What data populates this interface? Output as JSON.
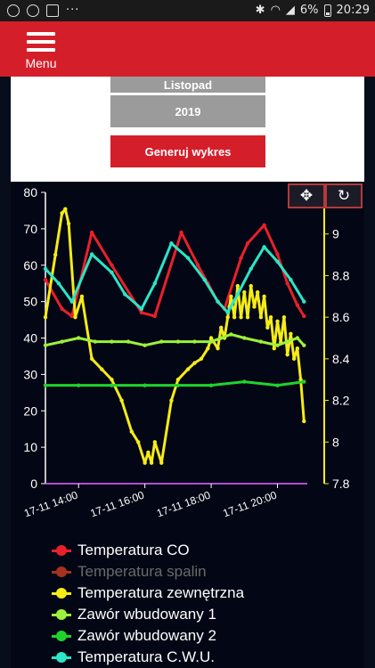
{
  "status_bar": {
    "left_icons": [
      "chrome-icon",
      "shield-icon",
      "image-icon",
      "more-dots-icon"
    ],
    "dots": "···",
    "battery": "6%",
    "time": "20:29"
  },
  "app_bar": {
    "menu_label": "Menu"
  },
  "controls": {
    "month": "Listopad",
    "year": "2019",
    "generate": "Generuj wykres"
  },
  "chart_data": {
    "type": "line",
    "x_tick_labels": [
      "17-11 14:00",
      "17-11 16:00",
      "17-11 18:00",
      "17-11 20:00"
    ],
    "x_tick_hours": [
      14,
      16,
      18,
      20
    ],
    "x_range_hours": [
      13.0,
      20.9
    ],
    "y_left": {
      "ylim": [
        0,
        80
      ],
      "ticks": [
        0,
        10,
        20,
        30,
        40,
        50,
        60,
        70,
        80
      ]
    },
    "y_right": {
      "ylim": [
        7.8,
        9.2
      ],
      "ticks": [
        "7.8",
        "8",
        "8.2",
        "8.4",
        "8.6",
        "8.8",
        "9"
      ]
    },
    "series": [
      {
        "name": "Temperatura CO",
        "color": "#e8202a",
        "axis": "left",
        "x": [
          13.0,
          13.5,
          13.8,
          14.4,
          15.0,
          15.9,
          16.3,
          17.1,
          17.6,
          17.9,
          18.2,
          18.4,
          18.9,
          19.1,
          19.6,
          20.0,
          20.3,
          20.6,
          20.8
        ],
        "y": [
          56,
          48,
          46,
          69,
          60,
          47,
          46,
          69,
          60,
          55,
          50,
          48,
          62,
          66,
          71,
          63,
          55,
          49,
          46
        ]
      },
      {
        "name": "Temperatura spalin",
        "color": "#a6321f",
        "axis": "left",
        "dim": true,
        "x": [],
        "y": []
      },
      {
        "name": "Temperatura zewnętrzna",
        "color": "#f5ec17",
        "axis": "right",
        "x": [
          13.0,
          13.3,
          13.5,
          13.6,
          13.7,
          13.9,
          14.1,
          14.4,
          14.7,
          15.0,
          15.3,
          15.6,
          15.8,
          16.0,
          16.1,
          16.2,
          16.3,
          16.5,
          16.8,
          17.0,
          17.3,
          17.5,
          17.7,
          17.9,
          18.0,
          18.2,
          18.3,
          18.4,
          18.5,
          18.55,
          18.6,
          18.7,
          18.8,
          18.9,
          19.0,
          19.1,
          19.2,
          19.3,
          19.4,
          19.5,
          19.6,
          19.7,
          19.8,
          19.9,
          20.0,
          20.1,
          20.2,
          20.3,
          20.4,
          20.5,
          20.6,
          20.7,
          20.8
        ],
        "y": [
          8.6,
          8.9,
          9.1,
          9.12,
          9.05,
          8.6,
          8.7,
          8.4,
          8.35,
          8.3,
          8.2,
          8.05,
          8.0,
          7.9,
          7.95,
          7.9,
          8.0,
          7.9,
          8.2,
          8.3,
          8.35,
          8.38,
          8.4,
          8.45,
          8.5,
          8.45,
          8.55,
          8.5,
          8.6,
          8.65,
          8.7,
          8.6,
          8.75,
          8.6,
          8.72,
          8.6,
          8.75,
          8.65,
          8.72,
          8.6,
          8.7,
          8.55,
          8.6,
          8.45,
          8.58,
          8.48,
          8.6,
          8.42,
          8.52,
          8.4,
          8.45,
          8.3,
          8.1
        ]
      },
      {
        "name": "Zawór wbudowany 1",
        "color": "#9cf23a",
        "axis": "left",
        "x": [
          13.0,
          13.5,
          14.0,
          14.5,
          15.0,
          15.5,
          16.0,
          16.5,
          17.0,
          17.5,
          18.0,
          18.3,
          18.6,
          19.0,
          19.5,
          20.0,
          20.3,
          20.6,
          20.8
        ],
        "y": [
          38,
          39,
          40,
          39,
          39,
          39,
          38,
          39,
          39,
          39,
          39,
          40,
          41,
          40,
          39,
          38,
          39,
          40,
          38
        ]
      },
      {
        "name": "Zawór wbudowany 2",
        "color": "#20d32c",
        "axis": "left",
        "x": [
          13.0,
          14.0,
          15.0,
          16.0,
          17.0,
          18.0,
          19.0,
          20.0,
          20.8
        ],
        "y": [
          27,
          27,
          27,
          27,
          27,
          27,
          28,
          27,
          28
        ]
      },
      {
        "name": "Temperatura C.W.U.",
        "color": "#2be6c7",
        "axis": "left",
        "x": [
          13.0,
          13.4,
          13.8,
          14.4,
          15.0,
          15.4,
          15.9,
          16.3,
          16.8,
          17.3,
          17.8,
          18.2,
          18.5,
          18.8,
          19.2,
          19.6,
          20.0,
          20.4,
          20.8
        ],
        "y": [
          59,
          55,
          50,
          63,
          58,
          52,
          48,
          55,
          66,
          62,
          56,
          50,
          47,
          52,
          59,
          65,
          61,
          56,
          50
        ]
      }
    ],
    "grid": false,
    "legend_placement": "bottom"
  },
  "toolbar": {
    "move_icon": "move-icon",
    "reset_icon": "reset-icon"
  }
}
